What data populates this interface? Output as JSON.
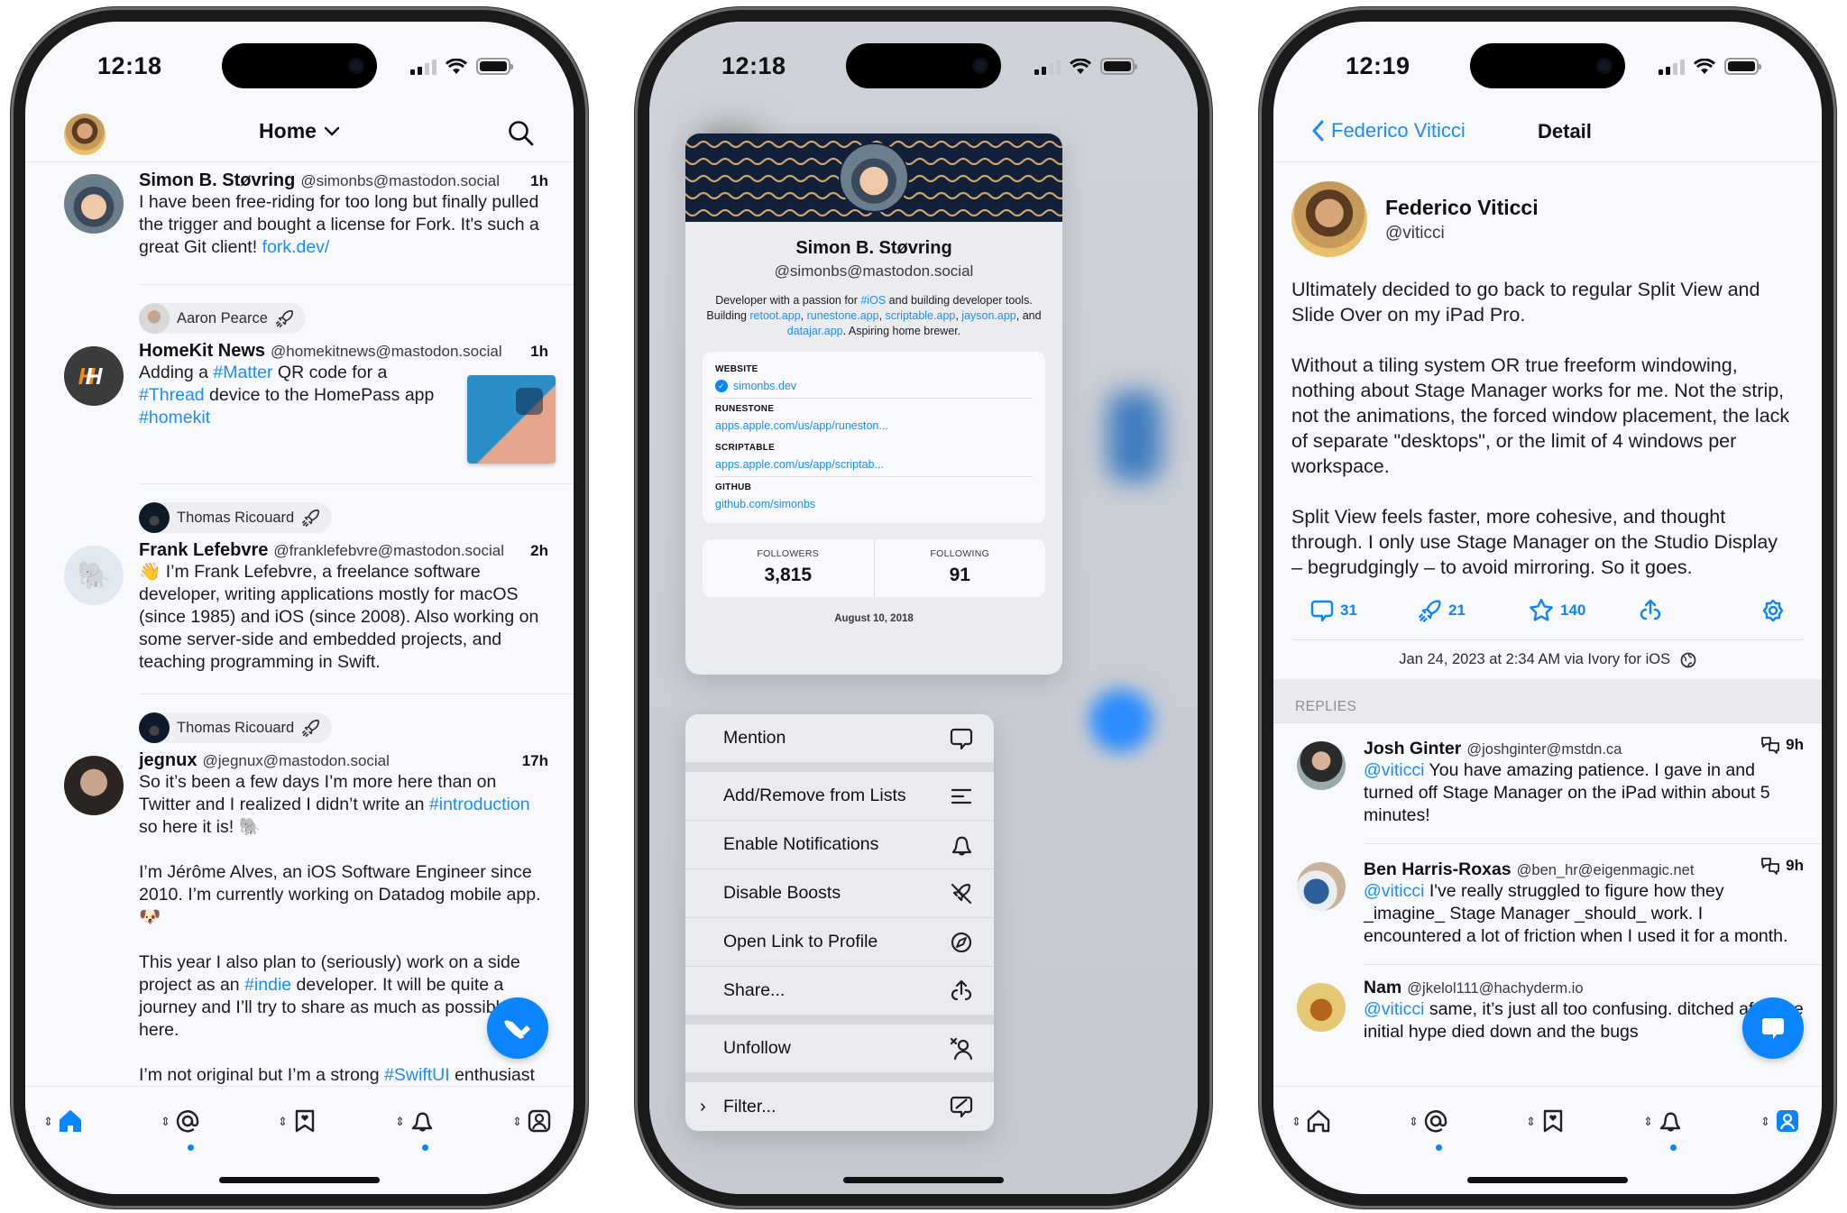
{
  "phones": [
    {
      "status": {
        "time": "12:18"
      },
      "header": {
        "title": "Home",
        "dropdown_icon": "chevron-down-icon",
        "search_icon": "search-icon"
      },
      "posts": [
        {
          "boosted_by": null,
          "name": "Simon B. Støvring",
          "handle": "@simonbs@mastodon.social",
          "time": "1h",
          "body_parts": [
            [
              "I have been free-riding for too long but finally pulled the trigger and bought a license for Fork. It's such a great Git client! ",
              "text"
            ],
            [
              "fork.dev/",
              "link"
            ]
          ]
        },
        {
          "boosted_by": "Aaron Pearce",
          "name": "HomeKit News",
          "handle": "@homekitnews@mastodon.social",
          "time": "1h",
          "body_parts": [
            [
              "Adding a ",
              "text"
            ],
            [
              "#Matter",
              "link"
            ],
            [
              " QR code for a ",
              "text"
            ],
            [
              "#Thread",
              "link"
            ],
            [
              " device to the  HomePass app ",
              "text"
            ],
            [
              "#homekit",
              "link"
            ]
          ],
          "has_media": true
        },
        {
          "boosted_by": "Thomas Ricouard",
          "name": "Frank Lefebvre",
          "handle": "@franklefebvre@mastodon.social",
          "time": "2h",
          "body_parts": [
            [
              "👋 I’m Frank Lefebvre, a freelance software developer, writing applications mostly for macOS (since 1985) and iOS (since 2008). Also working on some server-side and embedded projects, and teaching programming in Swift.",
              "text"
            ]
          ]
        },
        {
          "boosted_by": "Thomas Ricouard",
          "name": "jegnux",
          "handle": "@jegnux@mastodon.social",
          "time": "17h",
          "paragraphs": [
            [
              [
                "So it’s been a few days I’m more here than on Twitter and I realized I didn’t write an ",
                "text"
              ],
              [
                "#introduction",
                "link"
              ],
              [
                " so here it is! 🐘",
                "text"
              ]
            ],
            [
              [
                "I’m Jérôme Alves, an iOS Software Engineer since 2010. I’m currently working on Datadog mobile app. 🐶",
                "text"
              ]
            ],
            [
              [
                "This year I also plan to (seriously) work on a side project as an ",
                "text"
              ],
              [
                "#indie",
                "link"
              ],
              [
                " developer. It will be quite a journey and I’ll try to share as much as possible here.",
                "text"
              ]
            ],
            [
              [
                "I’m not original but I’m a strong ",
                "text"
              ],
              [
                "#SwiftUI",
                "link"
              ],
              [
                " enthusiast and I’ll also try to share some tips and tricks 🤓",
                "text"
              ]
            ]
          ]
        }
      ],
      "fab_icon": "megaphone-icon",
      "tabs": [
        {
          "name": "home",
          "active": true,
          "dot": false
        },
        {
          "name": "mentions",
          "active": false,
          "dot": true
        },
        {
          "name": "favorites",
          "active": false,
          "dot": false
        },
        {
          "name": "notifications",
          "active": false,
          "dot": true
        },
        {
          "name": "profile",
          "active": false,
          "dot": false
        }
      ]
    },
    {
      "status": {
        "time": "12:18"
      },
      "profile": {
        "name": "Simon B. Støvring",
        "handle": "@simonbs@mastodon.social",
        "bio_parts": [
          [
            "Developer with a passion for ",
            "text"
          ],
          [
            "#iOS",
            "link"
          ],
          [
            " and building developer tools. Building ",
            "text"
          ],
          [
            "retoot.app",
            "link"
          ],
          [
            ", ",
            "text"
          ],
          [
            "runestone.app",
            "link"
          ],
          [
            ", ",
            "text"
          ],
          [
            "scriptable.app",
            "link"
          ],
          [
            ", ",
            "text"
          ],
          [
            "jayson.app",
            "link"
          ],
          [
            ", and ",
            "text"
          ],
          [
            "datajar.app",
            "link"
          ],
          [
            ". Aspiring home brewer.",
            "text"
          ]
        ],
        "fields": [
          {
            "label": "WEBSITE",
            "value": "simonbs.dev",
            "verified": true
          },
          {
            "label": "RUNESTONE",
            "value": "apps.apple.com/us/app/runeston...",
            "verified": false
          },
          {
            "label": "SCRIPTABLE",
            "value": "apps.apple.com/us/app/scriptab...",
            "verified": false
          },
          {
            "label": "GITHUB",
            "value": "github.com/simonbs",
            "verified": false
          }
        ],
        "followers_label": "FOLLOWERS",
        "followers": "3,815",
        "following_label": "FOLLOWING",
        "following": "91",
        "joined": "August 10, 2018"
      },
      "menu": [
        {
          "label": "Mention",
          "icon": "mention-bubble-icon"
        },
        {
          "label": "Add/Remove from Lists",
          "icon": "list-icon"
        },
        {
          "label": "Enable Notifications",
          "icon": "bell-icon"
        },
        {
          "label": "Disable Boosts",
          "icon": "boost-off-icon"
        },
        {
          "label": "Open Link to Profile",
          "icon": "compass-icon"
        },
        {
          "label": "Share...",
          "icon": "share-icon"
        },
        {
          "label": "Unfollow",
          "icon": "unfollow-icon"
        },
        {
          "label": "Filter...",
          "icon": "filter-bubble-icon",
          "submenu": true
        }
      ]
    },
    {
      "status": {
        "time": "12:19"
      },
      "header": {
        "back_label": "Federico Viticci",
        "title": "Detail"
      },
      "post": {
        "name": "Federico Viticci",
        "handle": "@viticci",
        "paragraphs": [
          "Ultimately decided to go back to regular Split View and Slide Over on my iPad Pro.",
          "Without a tiling system OR true freeform windowing, nothing about Stage Manager works for me. Not the strip, not the animations, the forced window placement, the lack of separate \"desktops\", or the limit of 4 windows per workspace.",
          "Split View feels faster, more cohesive, and thought through. I only use Stage Manager on the Studio Display – begrudgingly – to avoid mirroring. So it goes."
        ],
        "replies_count": "31",
        "boosts_count": "21",
        "favorites_count": "140",
        "meta": "Jan 24, 2023 at 2:34 AM via Ivory for iOS"
      },
      "replies_header": "REPLIES",
      "replies": [
        {
          "name": "Josh Ginter",
          "handle": "@joshginter@mstdn.ca",
          "time": "9h",
          "mention": "@viticci",
          "text": " You have amazing patience. I gave in and turned off Stage Manager on the iPad within about 5 minutes!"
        },
        {
          "name": "Ben Harris-Roxas",
          "handle": "@ben_hr@eigenmagic.net",
          "time": "9h",
          "mention": "@viticci",
          "text": " I've really struggled to figure how they _imagine_ Stage Manager _should_ work. I encountered a lot of friction when I used it for a month."
        },
        {
          "name": "Nam",
          "handle": "@jkelol111@hachyderm.io",
          "time": "",
          "mention": "@viticci",
          "text": " same, it’s just all too confusing. ditched after the initial hype died down and the bugs"
        }
      ],
      "fab_icon": "reply-bubble-icon",
      "tabs": [
        {
          "name": "home",
          "active": false,
          "dot": false
        },
        {
          "name": "mentions",
          "active": false,
          "dot": true
        },
        {
          "name": "favorites",
          "active": false,
          "dot": false
        },
        {
          "name": "notifications",
          "active": false,
          "dot": true
        },
        {
          "name": "profile",
          "active": true,
          "dot": false
        }
      ]
    }
  ],
  "colors": {
    "accent": "#0a84ff",
    "link": "#1a8cff",
    "banner": "#12213a",
    "banner_wave": "#d4a66a"
  }
}
